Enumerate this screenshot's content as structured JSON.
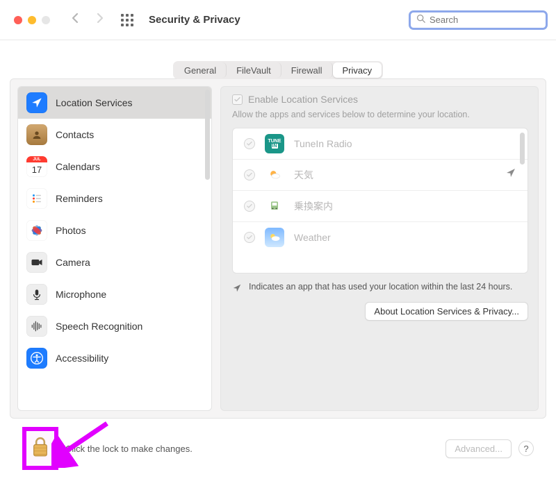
{
  "window": {
    "title": "Security & Privacy"
  },
  "search": {
    "placeholder": "Search"
  },
  "tabs": {
    "items": [
      {
        "label": "General"
      },
      {
        "label": "FileVault"
      },
      {
        "label": "Firewall"
      },
      {
        "label": "Privacy"
      }
    ],
    "active_index": 3
  },
  "sidebar": {
    "items": [
      {
        "label": "Location Services",
        "icon": "location"
      },
      {
        "label": "Contacts",
        "icon": "contacts"
      },
      {
        "label": "Calendars",
        "icon": "calendar",
        "badge": "17",
        "dow": "JUL"
      },
      {
        "label": "Reminders",
        "icon": "reminders"
      },
      {
        "label": "Photos",
        "icon": "photos"
      },
      {
        "label": "Camera",
        "icon": "camera"
      },
      {
        "label": "Microphone",
        "icon": "microphone"
      },
      {
        "label": "Speech Recognition",
        "icon": "speech"
      },
      {
        "label": "Accessibility",
        "icon": "accessibility"
      }
    ],
    "selected_index": 0
  },
  "right": {
    "enable_label": "Enable Location Services",
    "desc": "Allow the apps and services below to determine your location.",
    "apps": [
      {
        "name": "TuneIn Radio",
        "checked": true,
        "recent": false,
        "icon": "tunein"
      },
      {
        "name": "天気",
        "checked": true,
        "recent": true,
        "icon": "yahoo-weather"
      },
      {
        "name": "乗換案内",
        "checked": true,
        "recent": false,
        "icon": "transit"
      },
      {
        "name": "Weather",
        "checked": true,
        "recent": false,
        "icon": "weather"
      }
    ],
    "indicator_text": "Indicates an app that has used your location within the last 24 hours.",
    "about_button": "About Location Services & Privacy..."
  },
  "footer": {
    "lock_text": "Click the lock to make changes.",
    "advanced_button": "Advanced...",
    "help_button": "?"
  }
}
